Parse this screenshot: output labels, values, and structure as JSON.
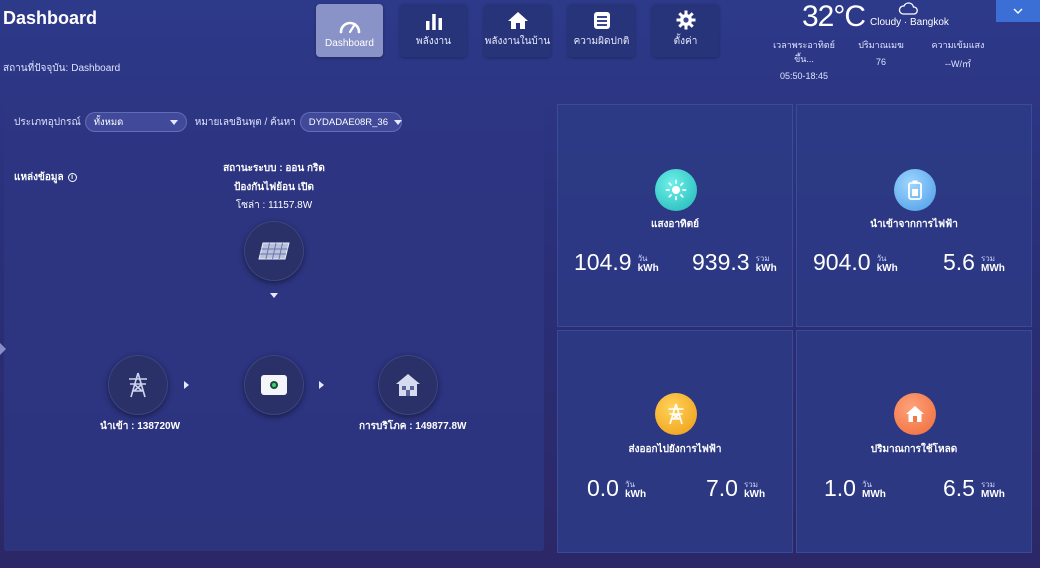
{
  "page": {
    "title": "Dashboard",
    "crumb_prefix": "สถานที่ปัจจุบัน:",
    "crumb_value": "Dashboard"
  },
  "nav": [
    {
      "label": "Dashboard",
      "icon": "gauge-icon",
      "active": true
    },
    {
      "label": "พลังงาน",
      "icon": "bar-chart-icon",
      "active": false
    },
    {
      "label": "พลังงานในบ้าน",
      "icon": "home-icon",
      "active": false
    },
    {
      "label": "ความผิดปกติ",
      "icon": "alert-list-icon",
      "active": false
    },
    {
      "label": "ตั้งค่า",
      "icon": "gear-icon",
      "active": false
    }
  ],
  "weather": {
    "temperature": "32°C",
    "condition_city": "Cloudy · Bangkok",
    "sun_label": "เวลาพระอาทิตย์ขึ้น...",
    "sun_value": "05:50-18:45",
    "cloud_label": "ปริมาณเมฆ",
    "cloud_value": "76",
    "irr_label": "ความเข้มแสง",
    "irr_value": "--W/㎡"
  },
  "filters": {
    "device_type_label": "ประเภทอุปกรณ์",
    "device_type_value": "ทั้งหมด",
    "serial_label": "หมายเลขอินพุต / ค้นหา",
    "serial_value": "DYDADAE08R_36"
  },
  "flow": {
    "source_label": "แหล่งข้อมูล",
    "status_line": "สถานะระบบ : ออน กริด",
    "backflow_line": "ป้องกันไฟย้อน เปิด",
    "solar_line": "โซล่า : 11157.8W",
    "grid_label": "นำเข้า : 138720W",
    "load_label": "การบริโภค : 149877.8W"
  },
  "cards": [
    {
      "label": "แสงอาทิตย์",
      "icon": "sun-icon",
      "color": "#2ec4c4",
      "day_value": "104.9",
      "day_tag": "วัน",
      "day_unit": "kWh",
      "total_value": "939.3",
      "total_tag": "รวม",
      "total_unit": "kWh"
    },
    {
      "label": "นำเข้าจากการไฟฟ้า",
      "icon": "battery-icon",
      "color": "#5aa8e8",
      "day_value": "904.0",
      "day_tag": "วัน",
      "day_unit": "kWh",
      "total_value": "5.6",
      "total_tag": "รวม",
      "total_unit": "MWh"
    },
    {
      "label": "ส่งออกไปยังการไฟฟ้า",
      "icon": "power-tower-icon",
      "color": "#f0a020",
      "day_value": "0.0",
      "day_tag": "วัน",
      "day_unit": "kWh",
      "total_value": "7.0",
      "total_tag": "รวม",
      "total_unit": "kWh"
    },
    {
      "label": "ปริมาณการใช้โหลด",
      "icon": "home-icon",
      "color": "#f07a40",
      "day_value": "1.0",
      "day_tag": "วัน",
      "day_unit": "MWh",
      "total_value": "6.5",
      "total_tag": "รวม",
      "total_unit": "MWh"
    }
  ]
}
